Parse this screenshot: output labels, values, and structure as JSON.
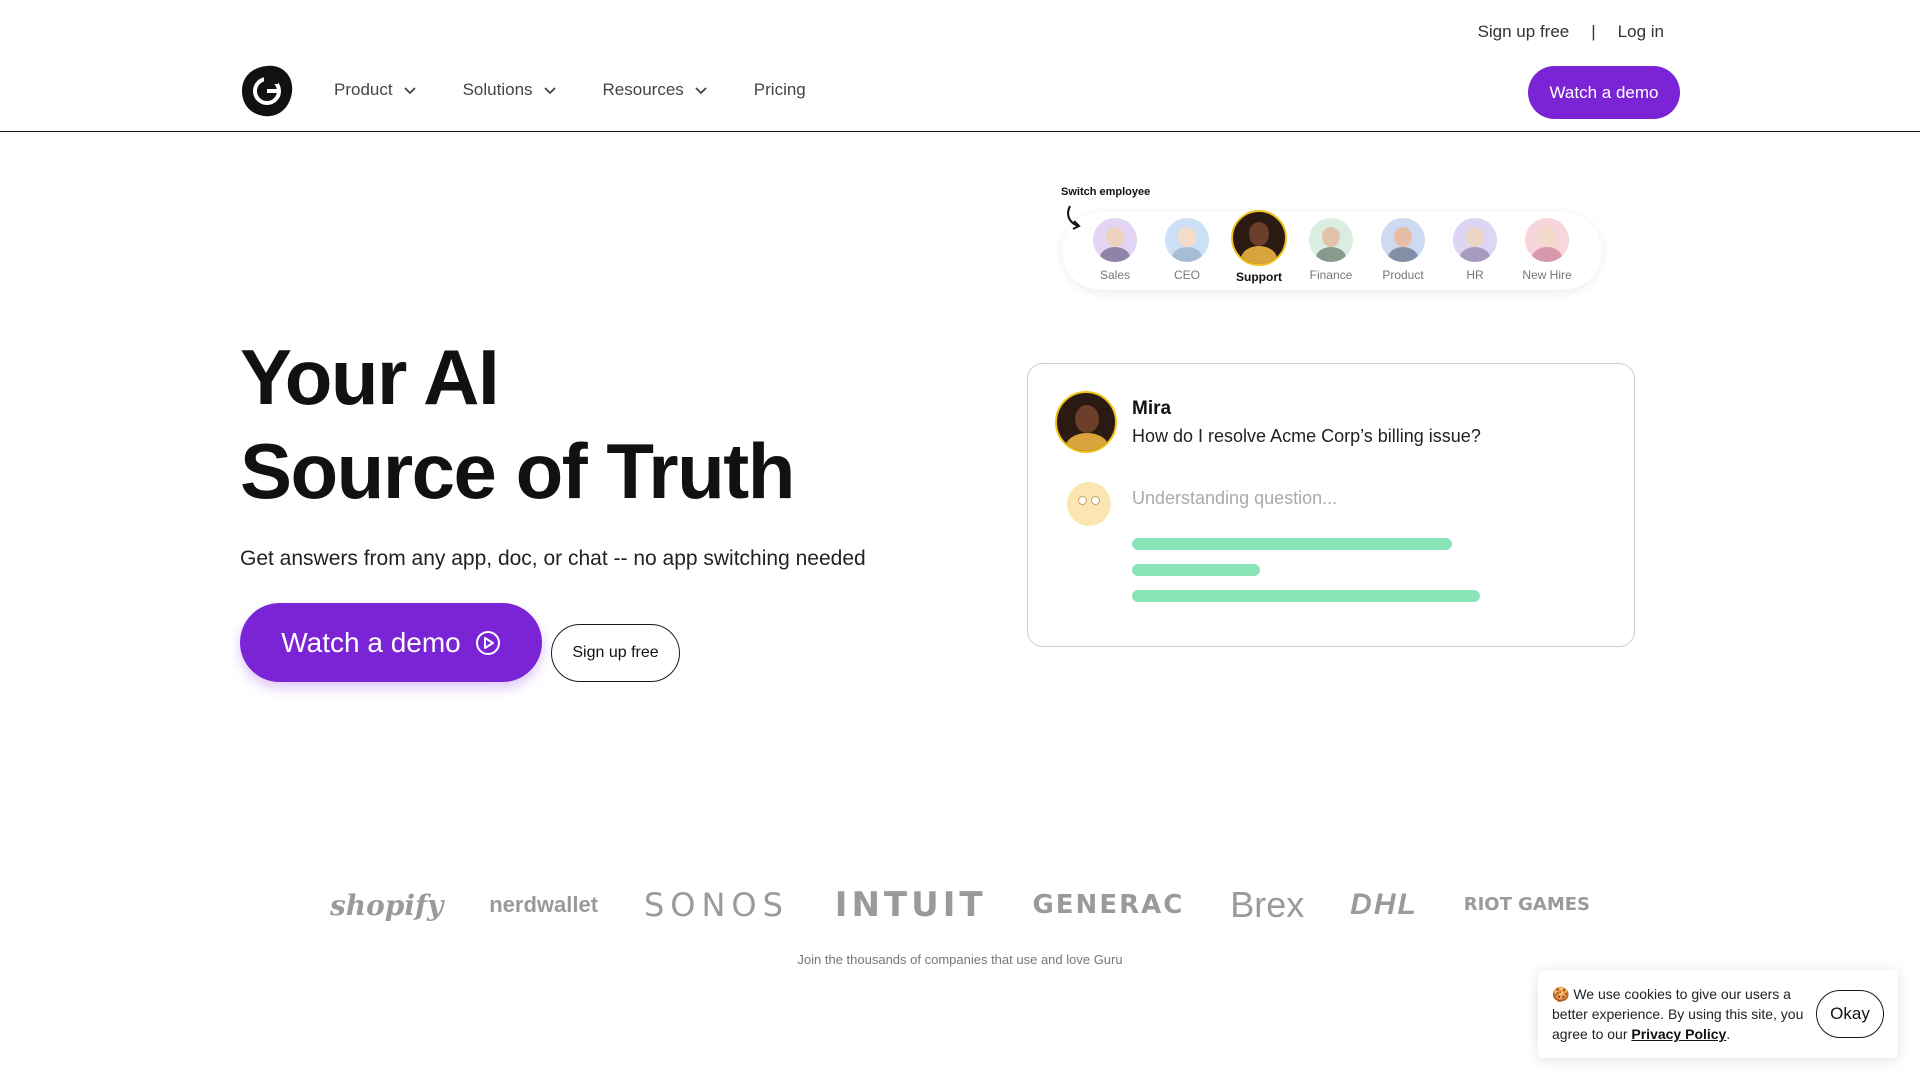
{
  "header": {
    "top_links": {
      "signup": "Sign up free",
      "separator": "|",
      "login": "Log in"
    },
    "nav": [
      {
        "label": "Product",
        "has_dropdown": true
      },
      {
        "label": "Solutions",
        "has_dropdown": true
      },
      {
        "label": "Resources",
        "has_dropdown": true
      },
      {
        "label": "Pricing",
        "has_dropdown": false
      }
    ],
    "cta": "Watch a demo",
    "logo_icon": "guru-logo"
  },
  "hero": {
    "title_line1": "Your AI",
    "title_line2": "Source of Truth",
    "subtitle": "Get answers from any app, doc, or chat -- no app switching needed",
    "primary_button": "Watch a demo",
    "secondary_button": "Sign up free"
  },
  "switcher": {
    "label": "Switch employee",
    "employees": [
      {
        "label": "Sales",
        "active": false,
        "bg": "#d9c6f0",
        "skin": "#e8c4a8",
        "shirt": "#6a5a8a"
      },
      {
        "label": "CEO",
        "active": false,
        "bg": "#bcd6f2",
        "skin": "#f0d2b8",
        "shirt": "#8aa8c8"
      },
      {
        "label": "Support",
        "active": true,
        "bg": "#2b1a12",
        "skin": "#6b3f2a",
        "shirt": "#d8a43b"
      },
      {
        "label": "Finance",
        "active": false,
        "bg": "#cde8d8",
        "skin": "#d8b090",
        "shirt": "#607a68"
      },
      {
        "label": "Product",
        "active": false,
        "bg": "#bcd0ee",
        "skin": "#e0a888",
        "shirt": "#5a6a8a"
      },
      {
        "label": "HR",
        "active": false,
        "bg": "#d4c8ee",
        "skin": "#e8c8b0",
        "shirt": "#8a7aa8"
      },
      {
        "label": "New Hire",
        "active": false,
        "bg": "#f4c8d0",
        "skin": "#f0d0b8",
        "shirt": "#c87890"
      }
    ]
  },
  "chat": {
    "name": "Mira",
    "question": "How do I resolve Acme Corp’s billing issue?",
    "status": "Understanding question..."
  },
  "logos": {
    "brands": [
      "shopify",
      "nerdwallet",
      "SONOS",
      "INTUIT",
      "GENERAC",
      "Brex",
      "DHL",
      "RIOT GAMES"
    ],
    "caption": "Join the thousands of companies that use and love Guru"
  },
  "cookie": {
    "text_before": "We use cookies to give our users a better experience.  By using this site, you agree to our",
    "link": "Privacy Policy",
    "text_after": ".",
    "button": "Okay"
  },
  "colors": {
    "brand": "#7a24d6",
    "loading": "#7ee0b0"
  }
}
